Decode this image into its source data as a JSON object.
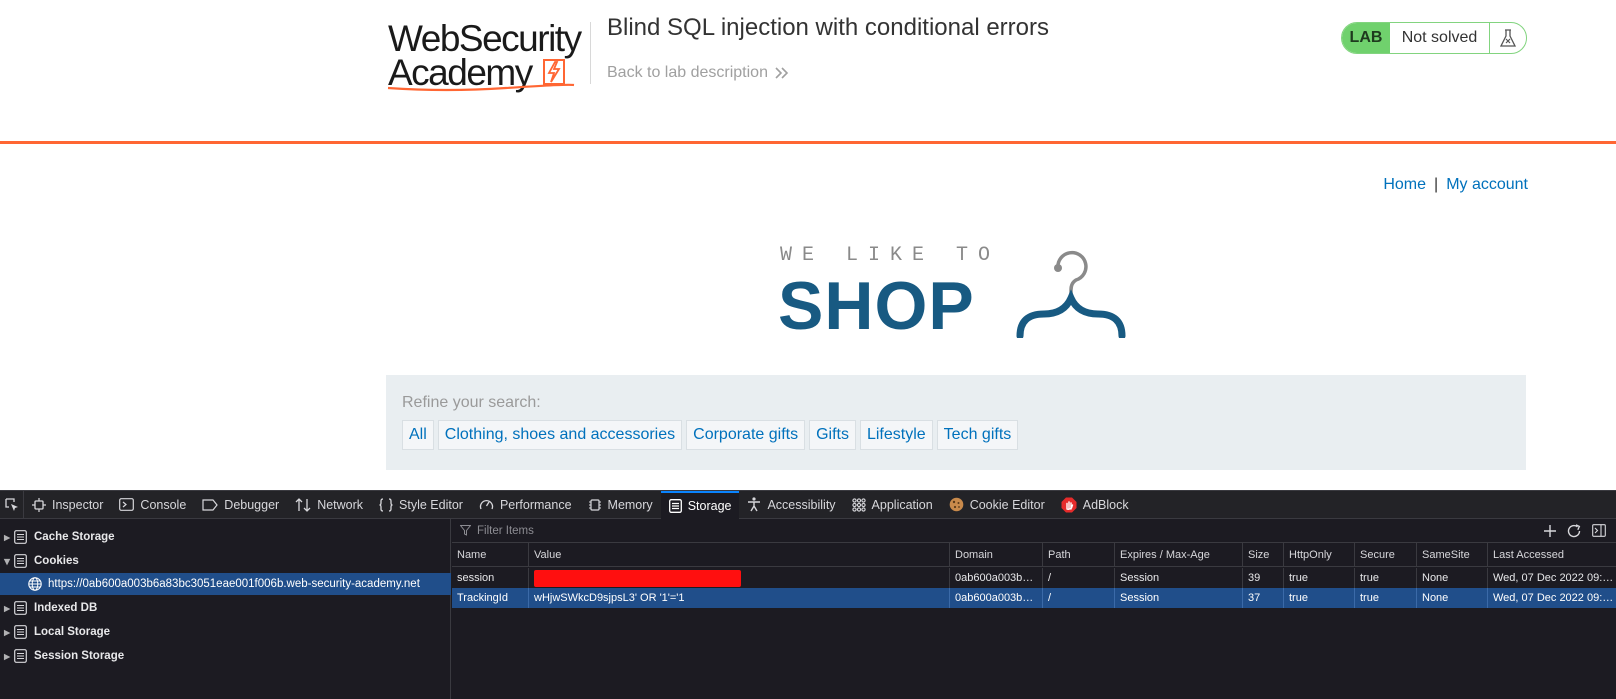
{
  "academy": {
    "logo_line1": "WebSecurity",
    "logo_line2": "Academy",
    "lab_title": "Blind SQL injection with conditional errors",
    "back_link": "Back to lab description",
    "lab_badge": "LAB",
    "lab_status": "Not solved"
  },
  "shop": {
    "nav": {
      "home": "Home",
      "separator": "|",
      "account": "My account"
    },
    "logo_tagline": "WE LIKE TO",
    "logo_brand": "SHOP",
    "refine_label": "Refine your search:",
    "filters": [
      "All",
      "Clothing, shoes and accessories",
      "Corporate gifts",
      "Gifts",
      "Lifestyle",
      "Tech gifts"
    ]
  },
  "devtools": {
    "tabs": [
      "Inspector",
      "Console",
      "Debugger",
      "Network",
      "Style Editor",
      "Performance",
      "Memory",
      "Storage",
      "Accessibility",
      "Application",
      "Cookie Editor",
      "AdBlock"
    ],
    "active_tab": "Storage",
    "sidebar": {
      "cache_storage": "Cache Storage",
      "cookies": "Cookies",
      "cookie_origin": "https://0ab600a003b6a83bc3051eae001f006b.web-security-academy.net",
      "indexed_db": "Indexed DB",
      "local_storage": "Local Storage",
      "session_storage": "Session Storage"
    },
    "filter_placeholder": "Filter Items",
    "columns": [
      "Name",
      "Value",
      "Domain",
      "Path",
      "Expires / Max-Age",
      "Size",
      "HttpOnly",
      "Secure",
      "SameSite",
      "Last Accessed"
    ],
    "rows": [
      {
        "name": "session",
        "value": "",
        "value_redacted": true,
        "domain": "0ab600a003b…",
        "path": "/",
        "expires": "Session",
        "size": "39",
        "httponly": "true",
        "secure": "true",
        "samesite": "None",
        "last_accessed": "Wed, 07 Dec 2022 09:…"
      },
      {
        "name": "TrackingId",
        "value": "wHjwSWkcD9sjpsL3' OR '1'='1",
        "value_redacted": false,
        "domain": "0ab600a003b…",
        "path": "/",
        "expires": "Session",
        "size": "37",
        "httponly": "true",
        "secure": "true",
        "samesite": "None",
        "last_accessed": "Wed, 07 Dec 2022 09:…"
      }
    ],
    "selected_row": 1
  },
  "colors": {
    "accent_orange": "#ff6633",
    "link_blue": "#0071bc",
    "shop_blue": "#185a82",
    "lab_green": "#70d16d",
    "devtools_select": "#204e8a",
    "redact_red": "#ff0f0f"
  }
}
